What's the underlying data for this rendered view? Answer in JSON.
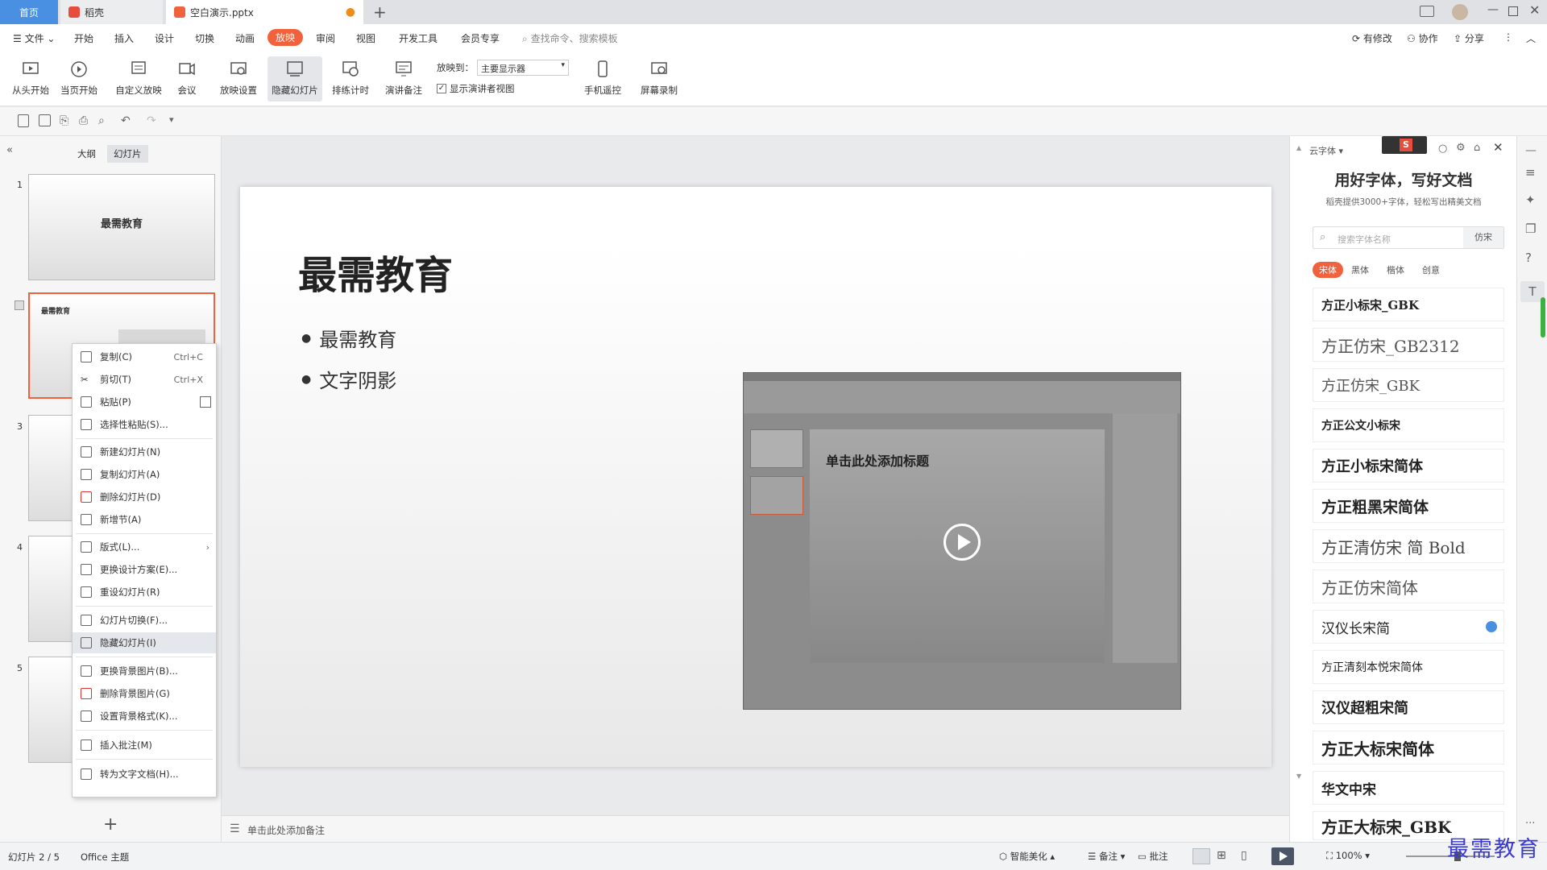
{
  "tabs": {
    "home": "首页",
    "daoke": "稻壳",
    "doc": "空白演示.pptx"
  },
  "menu": {
    "file": "文件",
    "items": [
      "开始",
      "插入",
      "设计",
      "切换",
      "动画"
    ],
    "active": "放映",
    "items2": [
      "审阅",
      "视图",
      "开发工具",
      "会员专享"
    ],
    "search": "查找命令、搜索模板",
    "edit": "有修改",
    "collab": "协作",
    "share": "分享"
  },
  "ribbon": {
    "from_start": "从头开始",
    "current_start": "当页开始",
    "custom": "自定义放映",
    "meeting": "会议",
    "settings": "放映设置",
    "hide": "隐藏幻灯片",
    "rehearse": "排练计时",
    "notes": "演讲备注",
    "play_to": "放映到：",
    "play_to_value": "主要显示器",
    "presenter_view": "显示演讲者视图",
    "remote": "手机遥控",
    "record": "屏幕录制"
  },
  "leftpane": {
    "tab_outline": "大纲",
    "tab_slides": "幻灯片",
    "thumb1_title": "最需教育",
    "thumb2_title": "最需教育",
    "nums": [
      "1",
      "3",
      "4",
      "5"
    ],
    "add": "+"
  },
  "context_menu": [
    {
      "label": "复制(C)",
      "shortcut": "Ctrl+C"
    },
    {
      "label": "剪切(T)",
      "shortcut": "Ctrl+X"
    },
    {
      "label": "粘贴(P)",
      "shortcut": ""
    },
    {
      "label": "选择性粘贴(S)...",
      "shortcut": ""
    },
    {
      "label": "新建幻灯片(N)",
      "shortcut": ""
    },
    {
      "label": "复制幻灯片(A)",
      "shortcut": ""
    },
    {
      "label": "删除幻灯片(D)",
      "shortcut": ""
    },
    {
      "label": "新增节(A)",
      "shortcut": ""
    },
    {
      "label": "版式(L)...",
      "shortcut": ""
    },
    {
      "label": "更换设计方案(E)...",
      "shortcut": ""
    },
    {
      "label": "重设幻灯片(R)",
      "shortcut": ""
    },
    {
      "label": "幻灯片切换(F)...",
      "shortcut": ""
    },
    {
      "label": "隐藏幻灯片(I)",
      "shortcut": ""
    },
    {
      "label": "更换背景图片(B)...",
      "shortcut": ""
    },
    {
      "label": "删除背景图片(G)",
      "shortcut": ""
    },
    {
      "label": "设置背景格式(K)...",
      "shortcut": ""
    },
    {
      "label": "插入批注(M)",
      "shortcut": ""
    },
    {
      "label": "转为文字文档(H)...",
      "shortcut": ""
    }
  ],
  "slide": {
    "title": "最需教育",
    "bullets": [
      "最需教育",
      "文字阴影"
    ],
    "video_title": "单击此处添加标题"
  },
  "notes": "单击此处添加备注",
  "fontpanel": {
    "header": "云字体",
    "headline": "用好字体，写好文档",
    "sub": "稻壳提供3000+字体，轻松写出精美文档",
    "search_placeholder": "搜索字体名称",
    "search_value": "仿宋",
    "cats": [
      "宋体",
      "黑体",
      "楷体",
      "创意"
    ],
    "fonts": [
      "方正小标宋_GBK",
      "方正仿宋_GB2312",
      "方正仿宋_GBK",
      "方正公文小标宋",
      "方正小标宋简体",
      "方正粗黑宋简体",
      "方正清仿宋 简 Bold",
      "方正仿宋简体",
      "汉仪长宋简",
      "方正清刻本悦宋简体",
      "汉仪超粗宋简",
      "方正大标宋简体",
      "华文中宋",
      "方正大标宋_GBK"
    ]
  },
  "status": {
    "slide": "幻灯片 2 / 5",
    "theme": "Office 主题",
    "beautify": "智能美化",
    "notes": "备注",
    "comments": "批注",
    "zoom": "100%"
  },
  "watermark": "最需教育"
}
